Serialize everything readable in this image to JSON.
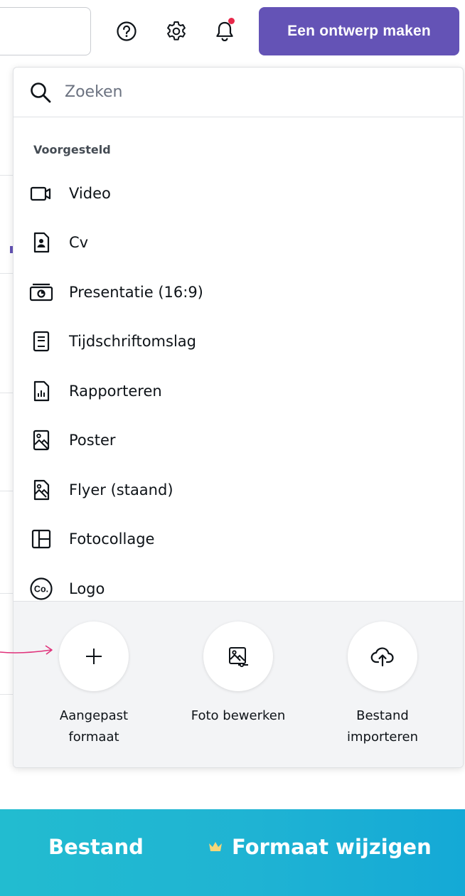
{
  "topbar": {
    "create_label": "Een ontwerp maken"
  },
  "icons": {
    "help": "help-circle-icon",
    "settings": "gear-icon",
    "notifications": "bell-icon"
  },
  "colors": {
    "accent": "#6453b6",
    "notification_dot": "#e8284a",
    "bottombar_start": "#22bcd0",
    "bottombar_end": "#14a9d6",
    "arrow": "#e0317a"
  },
  "panel": {
    "search_placeholder": "Zoeken",
    "section_title": "Voorgesteld",
    "items": [
      {
        "label": "Video",
        "icon": "video-icon"
      },
      {
        "label": "Cv",
        "icon": "resume-icon"
      },
      {
        "label": "Presentatie (16:9)",
        "icon": "presentation-icon"
      },
      {
        "label": "Tijdschriftomslag",
        "icon": "magazine-icon"
      },
      {
        "label": "Rapporteren",
        "icon": "report-icon"
      },
      {
        "label": "Poster",
        "icon": "poster-icon"
      },
      {
        "label": "Flyer (staand)",
        "icon": "flyer-icon"
      },
      {
        "label": "Fotocollage",
        "icon": "collage-icon"
      },
      {
        "label": "Logo",
        "icon": "logo-icon"
      }
    ],
    "actions": [
      {
        "line1": "Aangepast",
        "line2": "formaat",
        "icon": "plus-icon"
      },
      {
        "line1": "Foto bewerken",
        "line2": "",
        "icon": "edit-photo-icon"
      },
      {
        "line1": "Bestand",
        "line2": "importeren",
        "icon": "cloud-upload-icon"
      }
    ]
  },
  "bottombar": {
    "file_label": "Bestand",
    "resize_label": "Formaat wijzigen"
  }
}
